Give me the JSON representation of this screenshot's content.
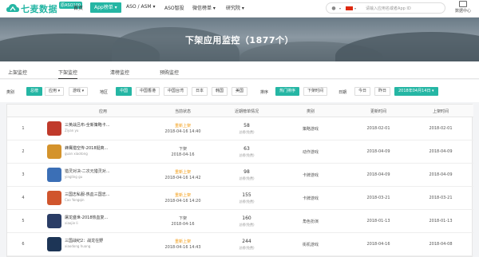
{
  "brand": {
    "name": "七麦数据",
    "badge": "原ASO100"
  },
  "nav": [
    {
      "label": "首页"
    },
    {
      "label": "App榜单 ▾",
      "active": true
    },
    {
      "label": "ASO / ASM ▾"
    },
    {
      "label": "ASO智投"
    },
    {
      "label": "微信榜单 ▾"
    },
    {
      "label": "研究院 ▾"
    }
  ],
  "search": {
    "placeholder": "请输入应用名或者App ID"
  },
  "data_center": {
    "label": "数据中心"
  },
  "hero": {
    "title": "下架应用监控（1877个）"
  },
  "tabs": [
    {
      "label": "上架监控"
    },
    {
      "label": "下架监控",
      "active": true
    },
    {
      "label": "清榜监控"
    },
    {
      "label": "预购监控"
    }
  ],
  "filters": {
    "category_label": "类别",
    "category": [
      "总榜",
      "应用 ▾",
      "游戏 ▾"
    ],
    "region_label": "地区",
    "region": [
      "中国",
      "中国香港",
      "中国台湾",
      "日本",
      "韩国",
      "美国"
    ],
    "sort_label": "排序",
    "sort": [
      "热门排序",
      "下架时间"
    ],
    "date_label": "日期",
    "date": [
      "今日",
      "昨日",
      "2018年04月14日 ▾"
    ]
  },
  "table": {
    "headers": [
      "应用",
      "当前状态",
      "近期榜单情况",
      "类别",
      "更新时间",
      "上架时间"
    ],
    "rows": [
      {
        "idx": "1",
        "name": "三英战吕布-全新策略卡...",
        "dev": "Ziyan yu",
        "status": "重新上架",
        "status_time": "2018-04-16 14:40",
        "rank": "58",
        "rank_note": "总榜(免费)",
        "category": "策略游戏",
        "updated": "2018-02-01",
        "listed": "2018-02-01",
        "icon": "#c03a2b"
      },
      {
        "idx": "2",
        "name": "蜂鹰猎空传-2018挺爽...",
        "dev": "guan xiaotong",
        "status": "下架",
        "status_time": "2018-04-16",
        "rank": "63",
        "rank_note": "总榜(免费)",
        "category": "动作游戏",
        "updated": "2018-04-09",
        "listed": "2018-04-09",
        "icon": "#d4932c"
      },
      {
        "idx": "3",
        "name": "猎灵对决-二次元猎灵对...",
        "dev": "yingling gu",
        "status": "重新上架",
        "status_time": "2018-04-16 14:42",
        "rank": "98",
        "rank_note": "总榜(免费)",
        "category": "卡牌游戏",
        "updated": "2018-04-09",
        "listed": "2018-04-09",
        "icon": "#3b6fb6"
      },
      {
        "idx": "4",
        "name": "三国志私服-热血三国志...",
        "dev": "Cao Yongqin",
        "status": "重新上架",
        "status_time": "2018-04-16 14:20",
        "rank": "155",
        "rank_note": "总榜(免费)",
        "category": "卡牌游戏",
        "updated": "2018-03-21",
        "listed": "2018-03-21",
        "icon": "#d0552d"
      },
      {
        "idx": "5",
        "name": "屠龙盛世-2018热血复...",
        "dev": "xiaojie li",
        "status": "下架",
        "status_time": "2018-04-16",
        "rank": "160",
        "rank_note": "总榜(免费)",
        "category": "角色扮演",
        "updated": "2018-01-13",
        "listed": "2018-01-13",
        "icon": "#2a3d66"
      },
      {
        "idx": "6",
        "name": "三国战纪2：战龙在野",
        "dev": "xiaodong huang",
        "status": "重新上架",
        "status_time": "2018-04-16 14:43",
        "rank": "244",
        "rank_note": "总榜(免费)",
        "category": "街机游戏",
        "updated": "2018-04-16",
        "listed": "2018-04-08",
        "icon": "#1d3556"
      }
    ]
  },
  "colors": {
    "accent": "#25b6a4",
    "status_up": "#f39c12"
  }
}
